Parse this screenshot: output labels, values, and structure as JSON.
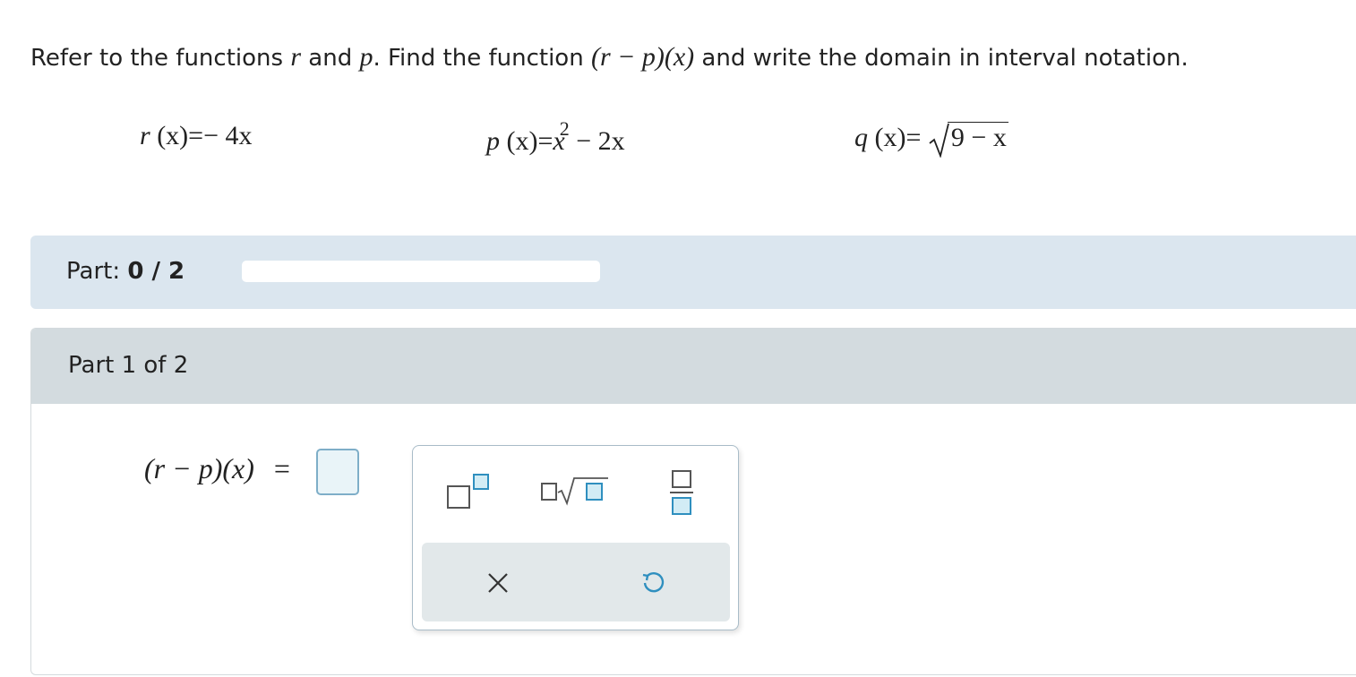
{
  "question": {
    "intro": "Refer to the functions",
    "var_r": "r",
    "and1": "and",
    "var_p": "p",
    "mid": ". Find the function",
    "expr": "(r − p)(x)",
    "outro": "and write the domain in interval notation."
  },
  "functions": {
    "r": {
      "name": "r",
      "arg": "(x)",
      "eq": "=",
      "rhs": "− 4x"
    },
    "p": {
      "name": "p",
      "arg": "(x)",
      "eq": "=",
      "base": "x",
      "exp": "2",
      "rest": "− 2x"
    },
    "q": {
      "name": "q",
      "arg": "(x)",
      "eq": "=",
      "radicand": "9 − x"
    }
  },
  "progress": {
    "label": "Part:",
    "value_text": "0 / 2",
    "fraction": 0.0
  },
  "part": {
    "title": "Part 1 of 2",
    "answer_lhs": "(r − p)(x)",
    "answer_eq": "="
  },
  "palette": {
    "tools": [
      "superscript-icon",
      "sqrt-icon",
      "fraction-icon"
    ],
    "actions": [
      "clear-icon",
      "undo-icon"
    ],
    "accent": "#2f8fbf"
  }
}
